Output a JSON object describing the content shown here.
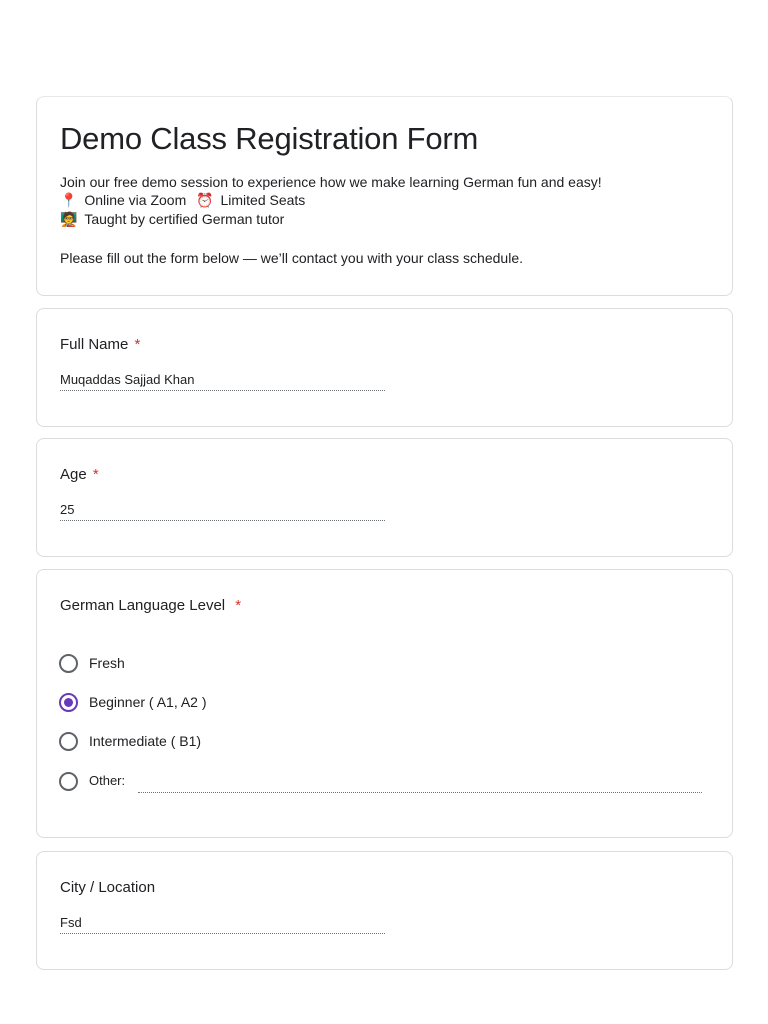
{
  "form": {
    "title": "Demo Class Registration Form",
    "description": {
      "line1": "Join our free demo session to experience how we make learning German fun and easy!",
      "pin_icon": "📍",
      "online_label": "Online via Zoom",
      "clock_icon": "⏰",
      "seats_label": "Limited Seats",
      "tutor_icon": "🧑‍🏫",
      "tutor_label": "Taught by certified German tutor",
      "note": "Please fill out the form below — we’ll contact you with your class schedule."
    }
  },
  "questions": {
    "full_name": {
      "label": "Full Name",
      "required_mark": "*",
      "value": "Muqaddas Sajjad Khan"
    },
    "age": {
      "label": "Age",
      "required_mark": "*",
      "value": "25"
    },
    "level": {
      "label": "German Language Level",
      "required_mark": "*",
      "options": [
        "Fresh",
        "Beginner ( A1, A2 )",
        "Intermediate ( B1)",
        "Other:"
      ],
      "selected": "Beginner ( A1, A2 )"
    },
    "city": {
      "label": "City / Location",
      "value": "Fsd"
    }
  },
  "colors": {
    "accent": "#673ab7",
    "required": "#d93025",
    "border": "#dadce0"
  }
}
